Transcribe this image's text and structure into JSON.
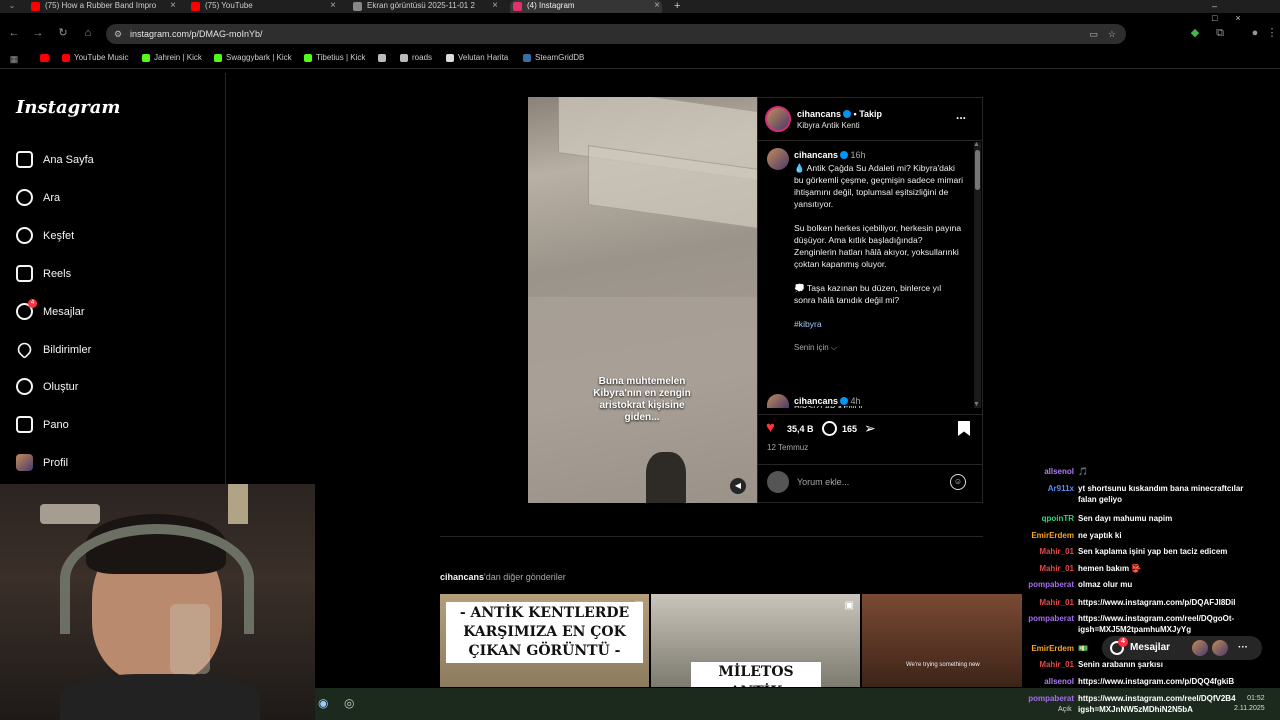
{
  "browser": {
    "tabs": [
      {
        "label": "(75) How a Rubber Band Impro",
        "color": "#ff0000"
      },
      {
        "label": "(75) YouTube",
        "color": "#ff0000"
      },
      {
        "label": "Ekran görüntüsü 2025-11-01 2",
        "color": "#888888"
      },
      {
        "label": "(4) Instagram",
        "color": "#e1306c"
      }
    ],
    "new_tab": "+",
    "url": "instagram.com/p/DMAG-moInYb/",
    "bookmarks": [
      {
        "label": "YouTube Music",
        "color": "#ff0000"
      },
      {
        "label": "Jahrein | Kick",
        "color": "#53fc18"
      },
      {
        "label": "Swaggybark | Kick",
        "color": "#53fc18"
      },
      {
        "label": "Tibetius | Kick",
        "color": "#53fc18"
      },
      {
        "label": "",
        "color": "#bbbbbb"
      },
      {
        "label": "roads",
        "color": "#bbbbbb"
      },
      {
        "label": "Velutan Harita",
        "color": "#dddddd"
      },
      {
        "label": "SteamGridDB",
        "color": "#3a6ea5"
      }
    ]
  },
  "sidebar": {
    "logo": "Instagram",
    "items": [
      {
        "label": "Ana Sayfa",
        "icon": "home-icon"
      },
      {
        "label": "Ara",
        "icon": "search-icon"
      },
      {
        "label": "Keşfet",
        "icon": "compass-icon"
      },
      {
        "label": "Reels",
        "icon": "reels-icon"
      },
      {
        "label": "Mesajlar",
        "icon": "messenger-icon",
        "badge": "4"
      },
      {
        "label": "Bildirimler",
        "icon": "heart-icon"
      },
      {
        "label": "Oluştur",
        "icon": "plus-icon"
      },
      {
        "label": "Pano",
        "icon": "dashboard-icon"
      },
      {
        "label": "Profil",
        "icon": "avatar-icon"
      }
    ]
  },
  "post": {
    "username": "cihancans",
    "follow": "• Takip",
    "location": "Kibyra Antik Kenti",
    "more": "...",
    "overlay_text": "Buna muhtemelen Kibyra'nın en zengin aristokrat kişisine giden...",
    "caption_user": "cihancans",
    "caption_time": "16h",
    "caption": [
      "💧 Antik Çağda Su Adaleti mi? Kibyra'daki bu görkemli çeşme, geçmişin sadece mimari ihtişamını değil, toplumsal eşitsizliğini de yansıtıyor.",
      "Su bolken herkes içebiliyor, herkesin payına düşüyor. Ama kıtlık başladığında? Zenginlerin hatları hâlâ akıyor, yoksullarınki çoktan kapanmış oluyor.",
      "💭 Taşa kazınan bu düzen, binlerce yıl sonra hâlâ tanıdık değil mi?"
    ],
    "hashtag": "#kibyra",
    "translation": "Senin için ⌵",
    "reply_user": "cihancans",
    "reply_time": "4h",
    "reply_preview": "HIRSIZLAR KENDİ...",
    "likes": "35,4 B",
    "comments": "165",
    "date": "12 Temmuz",
    "comment_placeholder": "Yorum ekle..."
  },
  "more_posts": {
    "title_user": "cihancans",
    "title_rest": "'dan diğer gönderiler",
    "tiles": [
      {
        "text": "- ANTİK KENTLERDE KARŞIMIZA EN ÇOK ÇIKAN GÖRÜNTÜ -"
      },
      {
        "text": "MİLETOS ANTİK"
      },
      {
        "text": "We're trying something new"
      }
    ]
  },
  "messages_pill": {
    "label": "Mesajlar",
    "badge": "4"
  },
  "chat": [
    {
      "name": "allsenol",
      "msg": "🎵",
      "color": "#b07cf5"
    },
    {
      "name": "Ar911x",
      "msg": "yt shortsunu kıskandım bana minecraftcılar falan geliyo",
      "color": "#5b8cf0"
    },
    {
      "name": "qpoinTR",
      "msg": "Sen dayı mahumu napim",
      "color": "#33d17a"
    },
    {
      "name": "EmirErdem",
      "msg": "ne yaptık ki",
      "color": "#f6a623"
    },
    {
      "name": "Mahir_01",
      "msg": "Sen kaplama işini yap ben taciz edicem",
      "color": "#e04848"
    },
    {
      "name": "Mahir_01",
      "msg": "hemen bakım 👺",
      "color": "#e04848"
    },
    {
      "name": "pompaberat",
      "msg": "olmaz olur mu",
      "color": "#a56cf0"
    },
    {
      "name": "Mahir_01",
      "msg": "https://www.instagram.com/p/DQAFJI8Dil",
      "color": "#e04848"
    },
    {
      "name": "pompaberat",
      "msg": "https://www.instagram.com/reel/DQgoOt- igsh=MXJ5M2tpamhuMXJyYg",
      "color": "#a56cf0"
    },
    {
      "name": "EmirErdem",
      "msg": "💵",
      "color": "#f6a623"
    },
    {
      "name": "Mahir_01",
      "msg": "Senin arabanın şarkısı",
      "color": "#e04848"
    },
    {
      "name": "allsenol",
      "msg": "https://www.instagram.com/p/DQQ4fgkiB",
      "color": "#b07cf5"
    },
    {
      "name": "pompaberat",
      "msg": "https://www.instagram.com/reel/DQfV2B4 igsh=MXJnNW5zMDhiN2N5bA",
      "color": "#a56cf0"
    }
  ],
  "taskbar": {
    "label_open": "Açık",
    "time": "01:52",
    "date": "2.11.2025"
  }
}
